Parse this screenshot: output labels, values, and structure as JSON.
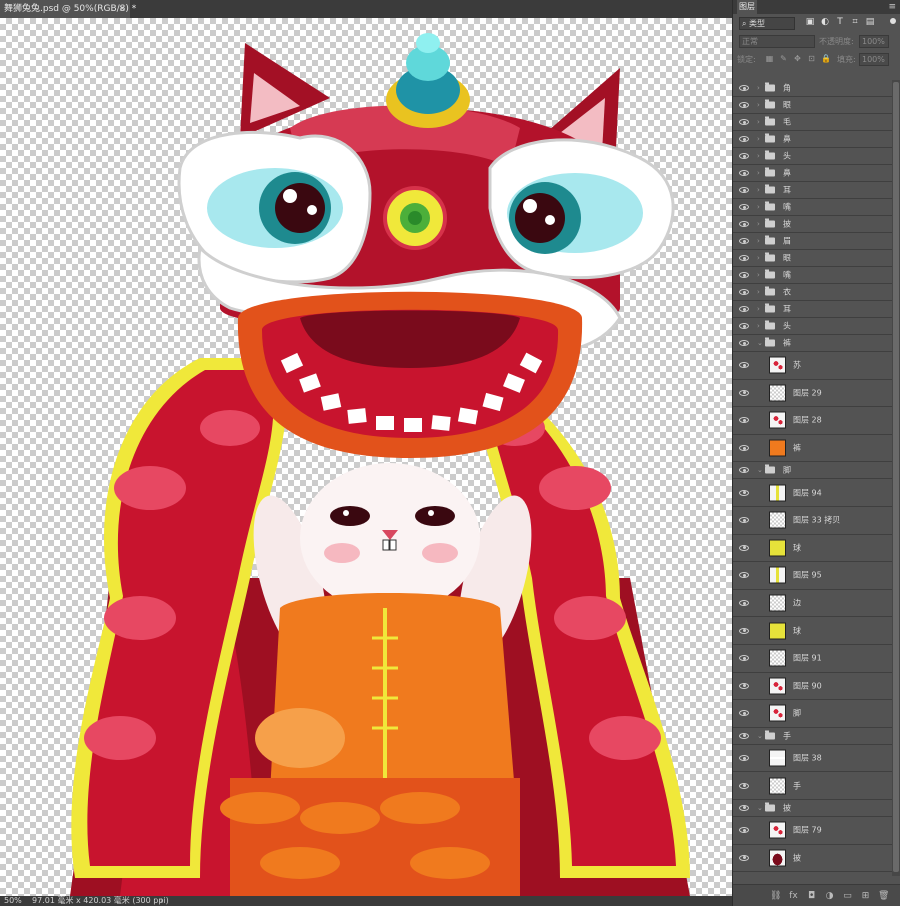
{
  "document": {
    "tab_title": "舞狮兔兔.psd @ 50%(RGB/8) *",
    "close": "×"
  },
  "status": {
    "zoom": "50%",
    "doc_info": "97.01 毫米 x 420.03 毫米 (300 ppi)",
    "arrow": "›"
  },
  "panel": {
    "tab_label": "图层",
    "menu_icon": "≡",
    "filter": {
      "kind_label": "类型",
      "icons": [
        "image-filter-icon",
        "adjustment-filter-icon",
        "type-filter-icon",
        "shape-filter-icon",
        "smart-object-filter-icon"
      ],
      "icon_glyphs": [
        "▣",
        "◐",
        "T",
        "⌗",
        "▤"
      ]
    },
    "blend": {
      "mode": "正常",
      "opacity_label": "不透明度:",
      "opacity_value": "100%"
    },
    "lock": {
      "label": "锁定:",
      "icons": [
        "lock-transparent-icon",
        "lock-paint-icon",
        "lock-move-icon",
        "lock-artboard-icon",
        "lock-all-icon"
      ],
      "icon_glyphs": [
        "▦",
        "✎",
        "✥",
        "⊡",
        "🔒"
      ],
      "fill_label": "填充:",
      "fill_value": "100%"
    },
    "layers": [
      {
        "type": "group",
        "name": "角"
      },
      {
        "type": "group",
        "name": "眼"
      },
      {
        "type": "group",
        "name": "毛"
      },
      {
        "type": "group",
        "name": "鼻"
      },
      {
        "type": "group",
        "name": "头"
      },
      {
        "type": "group",
        "name": "鼻"
      },
      {
        "type": "group",
        "name": "耳"
      },
      {
        "type": "group",
        "name": "嘴"
      },
      {
        "type": "group",
        "name": "披"
      },
      {
        "type": "group",
        "name": "眉"
      },
      {
        "type": "group",
        "name": "眼"
      },
      {
        "type": "group",
        "name": "嘴"
      },
      {
        "type": "group",
        "name": "衣"
      },
      {
        "type": "group",
        "name": "耳"
      },
      {
        "type": "group",
        "name": "头"
      },
      {
        "type": "group",
        "name": "裤",
        "expanded": true
      },
      {
        "type": "pixel",
        "name": "苏",
        "nested": true,
        "thumb": "red-marks"
      },
      {
        "type": "pixel",
        "name": "图层 29",
        "nested": true,
        "thumb": "blank"
      },
      {
        "type": "pixel",
        "name": "图层 28",
        "nested": true,
        "thumb": "red-marks"
      },
      {
        "type": "pixel",
        "name": "裤",
        "nested": true,
        "thumb": "orange"
      },
      {
        "type": "group",
        "name": "脚",
        "expanded": true
      },
      {
        "type": "pixel",
        "name": "图层 94",
        "nested": true,
        "thumb": "thin-yellow"
      },
      {
        "type": "pixel",
        "name": "图层 33 拷贝",
        "nested": true,
        "thumb": "blank"
      },
      {
        "type": "pixel",
        "name": "球",
        "nested": true,
        "thumb": "yellow"
      },
      {
        "type": "pixel",
        "name": "图层 95",
        "nested": true,
        "thumb": "thin-yellow"
      },
      {
        "type": "pixel",
        "name": "边",
        "nested": true,
        "thumb": "blank"
      },
      {
        "type": "pixel",
        "name": "球",
        "nested": true,
        "thumb": "yellow"
      },
      {
        "type": "pixel",
        "name": "图层 91",
        "nested": true,
        "thumb": "blank"
      },
      {
        "type": "pixel",
        "name": "图层 90",
        "nested": true,
        "thumb": "red-marks"
      },
      {
        "type": "pixel",
        "name": "脚",
        "nested": true,
        "thumb": "red-marks"
      },
      {
        "type": "group",
        "name": "手",
        "expanded": true
      },
      {
        "type": "pixel",
        "name": "图层 38",
        "nested": true,
        "thumb": "white-line"
      },
      {
        "type": "pixel",
        "name": "手",
        "nested": true,
        "thumb": "blank"
      },
      {
        "type": "group",
        "name": "披",
        "expanded": true
      },
      {
        "type": "pixel",
        "name": "图层 79",
        "nested": true,
        "thumb": "red-marks"
      },
      {
        "type": "pixel",
        "name": "披",
        "nested": true,
        "thumb": "dark-red"
      }
    ],
    "bottom_icons": [
      "link-layers-icon",
      "fx-icon",
      "add-mask-icon",
      "adjustment-layer-icon",
      "new-group-icon",
      "new-layer-icon",
      "delete-layer-icon"
    ],
    "bottom_glyphs": [
      "⛓",
      "fx",
      "◘",
      "◑",
      "▭",
      "⊞",
      "🗑"
    ]
  },
  "colors": {
    "accent_red": "#b3122b",
    "orange": "#f07a1e",
    "yellow": "#eef03c",
    "teal": "#2aa7a3"
  }
}
